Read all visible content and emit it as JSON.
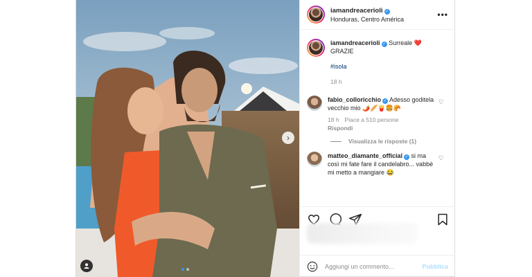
{
  "header": {
    "username": "iamandreacerioli",
    "location": "Honduras, Centro América",
    "more_icon": "more-horizontal-icon"
  },
  "caption": {
    "username": "iamandreacerioli",
    "text": "Surreale",
    "emoji": "❤️",
    "line2": "GRAZIE",
    "hashtag": "#isola",
    "time": "18 h"
  },
  "comments": [
    {
      "username": "fabio_colloricchio",
      "text": "Adesso goditela vecchio mio 🌶️🥖🍟🍔🥐",
      "time": "18 h",
      "likes": "Piace a 510 persone",
      "reply": "Rispondi",
      "view_replies": "Visualizza le risposte (1)"
    },
    {
      "username": "matteo_diamante_official",
      "text": "si ma così mi fate fare il candelabro... vabbè mi metto a mangiare 😂"
    }
  ],
  "actions": {
    "like_icon": "heart-icon",
    "comment_icon": "comment-icon",
    "share_icon": "paper-plane-icon",
    "save_icon": "bookmark-icon"
  },
  "add_comment": {
    "placeholder": "Aggiungi un commento...",
    "publish_label": "Pubblica",
    "emoji_icon": "smiley-icon"
  },
  "colors": {
    "link": "#00376b",
    "verified": "#3897f0",
    "muted": "#8e8e8e",
    "publish_disabled": "#b2dffc"
  }
}
